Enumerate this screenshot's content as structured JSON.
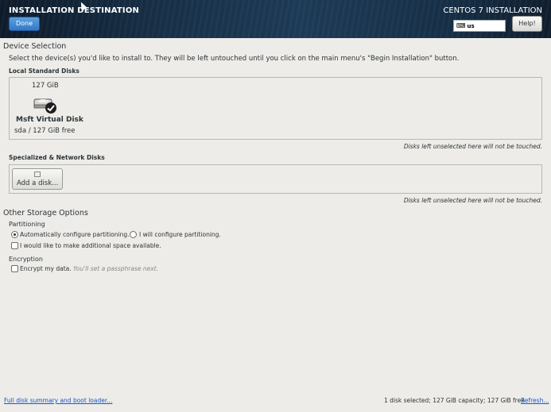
{
  "header": {
    "title": "INSTALLATION DESTINATION",
    "done_label": "Done",
    "product": "CENTOS 7 INSTALLATION",
    "keyboard_layout": "us",
    "help_label": "Help!"
  },
  "device_selection": {
    "title": "Device Selection",
    "intro": "Select the device(s) you'd like to install to.  They will be left untouched until you click on the main menu's \"Begin Installation\" button.",
    "local_label": "Local Standard Disks",
    "disks": [
      {
        "size": "127 GiB",
        "name": "Msft Virtual Disk",
        "detail": "sda  /  127 GiB free",
        "selected": true
      }
    ],
    "local_note": "Disks left unselected here will not be touched.",
    "network_label": "Specialized & Network Disks",
    "add_disk_label": "Add a disk...",
    "network_note": "Disks left unselected here will not be touched."
  },
  "storage_options": {
    "title": "Other Storage Options",
    "partitioning_label": "Partitioning",
    "auto_partition": "Automatically configure partitioning.",
    "manual_partition": "I will configure partitioning.",
    "partition_choice": "auto",
    "extra_space": "I would like to make additional space available.",
    "encryption_label": "Encryption",
    "encrypt": "Encrypt my data.",
    "encrypt_hint": "You'll set a passphrase next."
  },
  "footer": {
    "summary_link": "Full disk summary and boot loader...",
    "status": "1 disk selected; 127 GiB capacity; 127 GiB free",
    "refresh_link": "Refresh..."
  },
  "icons": {
    "keyboard": "keyboard-icon",
    "disk": "hard-disk-icon",
    "checkmark": "check-badge-icon",
    "add_disk": "add-disk-icon"
  }
}
